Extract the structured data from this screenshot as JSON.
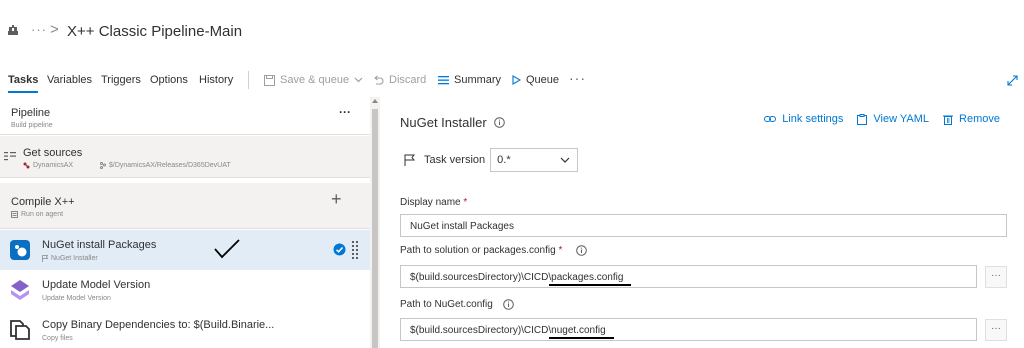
{
  "header": {
    "breadcrumb_ellipsis": "···",
    "breadcrumb_separator": ">",
    "title": "X++ Classic Pipeline-Main"
  },
  "toolbar": {
    "tabs": [
      "Tasks",
      "Variables",
      "Triggers",
      "Options",
      "History"
    ],
    "active_tab": "Tasks",
    "save_label": "Save & queue",
    "discard_label": "Discard",
    "summary_label": "Summary",
    "queue_label": "Queue",
    "more_label": "···"
  },
  "pipeline": {
    "title": "Pipeline",
    "subtitle": "Build pipeline",
    "more": "···",
    "get_sources": {
      "title": "Get sources",
      "repo": "DynamicsAX",
      "branch": "$/DynamicsAX/Releases/D365DevUAT"
    },
    "job": {
      "title": "Compile X++",
      "subtitle": "Run on agent",
      "add": "+"
    },
    "tasks": [
      {
        "title": "NuGet install Packages",
        "subtitle": "NuGet Installer"
      },
      {
        "title": "Update Model Version",
        "subtitle": "Update Model Version"
      },
      {
        "title": "Copy Binary Dependencies to: $(Build.Binarie...",
        "subtitle": "Copy files"
      }
    ]
  },
  "detail": {
    "title": "NuGet Installer",
    "actions": {
      "link_settings": "Link settings",
      "view_yaml": "View YAML",
      "remove": "Remove"
    },
    "task_version_label": "Task version",
    "task_version_value": "0.*",
    "display_name_label": "Display name",
    "display_name_value": "NuGet install Packages",
    "solution_path_label": "Path to solution or packages.config",
    "solution_path_prefix": "$(build.sourcesDirectory)\\CICD\\",
    "solution_path_file": "packages.config",
    "nuget_config_label": "Path to NuGet.config",
    "nuget_config_prefix": "$(build.sourcesDirectory)\\CICD\\",
    "nuget_config_file": "nuget.config",
    "required_marker": "*",
    "ellipsis": "···"
  },
  "colors": {
    "accent": "#0078d4",
    "selected_row": "#e1ecf7",
    "section_bg": "#f3f2f1"
  }
}
